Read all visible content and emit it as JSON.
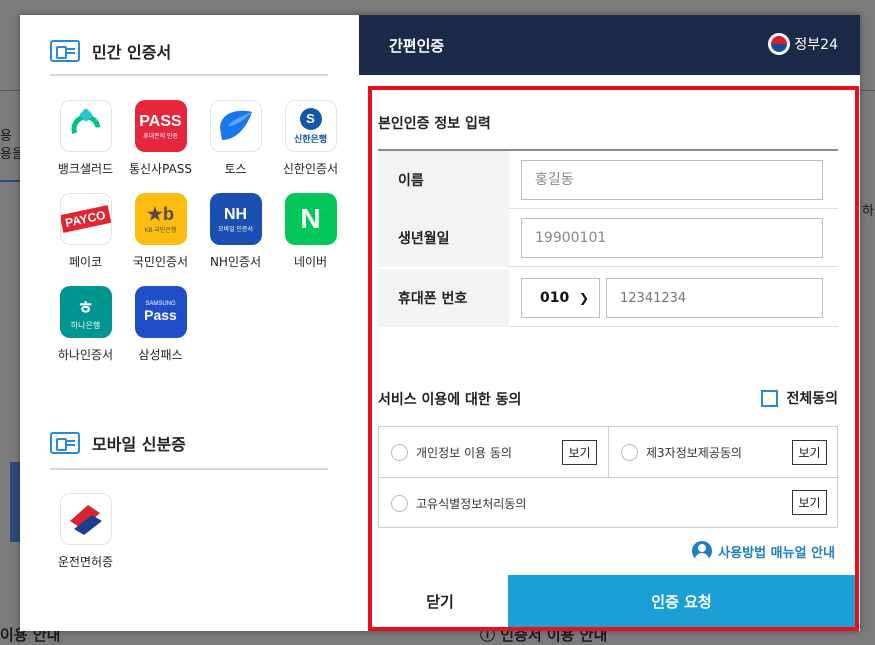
{
  "background": {
    "frag_left_1": "용",
    "frag_left_2": "용을",
    "frag_bottom_left": "이용 안내",
    "frag_bottom_right": "ⓘ 인증서 이용 안내",
    "frag_right": "하"
  },
  "left_panel": {
    "private_section_title": "민간 인증서",
    "private_apps": [
      {
        "label": "뱅크샐러드",
        "icon": "banksalad-icon"
      },
      {
        "label": "통신사PASS",
        "icon": "pass-icon",
        "icon_text": "PASS",
        "icon_sub": "휴대폰의 인증"
      },
      {
        "label": "토스",
        "icon": "toss-icon"
      },
      {
        "label": "신한인증서",
        "icon": "shinhan-icon",
        "icon_text": "신한은행"
      },
      {
        "label": "페이코",
        "icon": "payco-icon",
        "icon_text": "PAYCO"
      },
      {
        "label": "국민인증서",
        "icon": "kb-icon",
        "icon_text": "KB 국민은행"
      },
      {
        "label": "NH인증서",
        "icon": "nh-icon",
        "icon_text": "NH",
        "icon_sub": "모바일 인증서"
      },
      {
        "label": "네이버",
        "icon": "naver-icon",
        "icon_text": "N"
      },
      {
        "label": "하나인증서",
        "icon": "hana-icon",
        "icon_text": "하나은행"
      },
      {
        "label": "삼성패스",
        "icon": "samsung-pass-icon",
        "icon_text": "Pass",
        "icon_sub": "SAMSUNG"
      }
    ],
    "mobile_section_title": "모바일 신분증",
    "mobile_apps": [
      {
        "label": "운전면허증",
        "icon": "drivers-license-icon"
      }
    ]
  },
  "right_panel": {
    "header_title": "간편인증",
    "gov_logo_text": "정부24",
    "form_title": "본인인증 정보 입력",
    "name_label": "이름",
    "name_placeholder": "홍길동",
    "birth_label": "생년월일",
    "birth_placeholder": "19900101",
    "phone_label": "휴대폰 번호",
    "carrier_value": "010",
    "phone_placeholder": "12341234",
    "consent_title": "서비스 이용에 대한 동의",
    "agree_all_label": "전체동의",
    "consents": [
      {
        "label": "개인정보 이용 동의",
        "view": "보기"
      },
      {
        "label": "제3자정보제공동의",
        "view": "보기"
      },
      {
        "label": "고유식별정보처리동의",
        "view": "보기"
      }
    ],
    "manual_link": "사용방법 매뉴얼 안내",
    "close_button": "닫기",
    "request_button": "인증 요청"
  },
  "colors": {
    "header_bg": "#1c2a4a",
    "primary_button": "#1c9fd4",
    "highlight_frame": "#e8101a",
    "link": "#1d7ec6"
  }
}
